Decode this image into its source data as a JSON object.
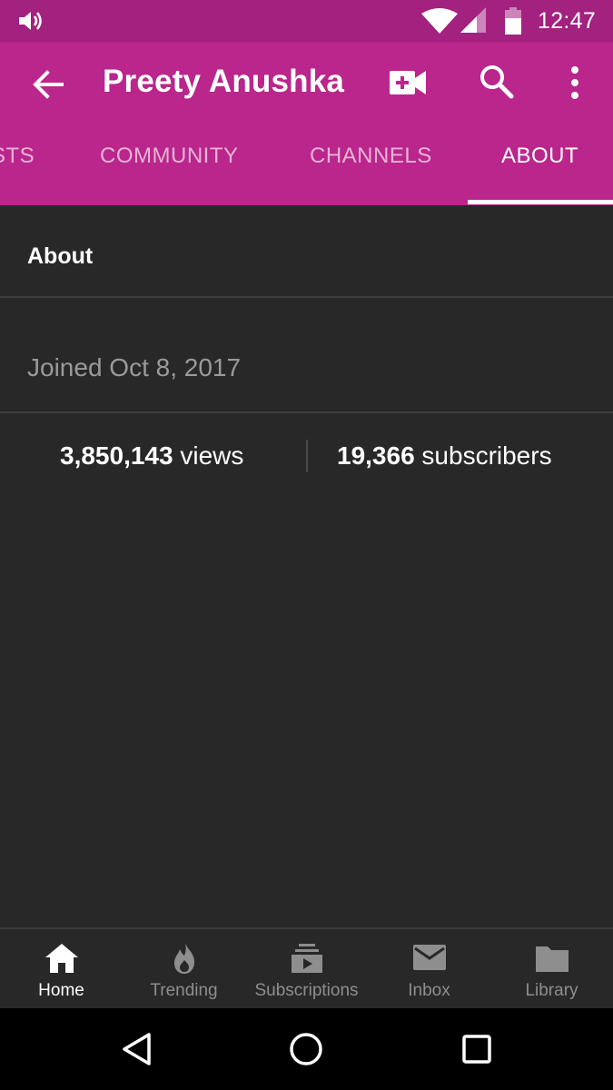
{
  "status_bar": {
    "time": "12:47",
    "icons": [
      "volume-icon",
      "wifi-icon",
      "signal-icon",
      "battery-icon"
    ]
  },
  "app_bar": {
    "title": "Preety Anushka",
    "icons": [
      "back-arrow-icon",
      "video-camera-add-icon",
      "search-icon",
      "more-vert-icon"
    ]
  },
  "tabs": [
    {
      "label": "STS",
      "active": false
    },
    {
      "label": "COMMUNITY",
      "active": false
    },
    {
      "label": "CHANNELS",
      "active": false
    },
    {
      "label": "ABOUT",
      "active": true
    }
  ],
  "about": {
    "section_title": "About",
    "joined": "Joined Oct 8, 2017",
    "views_count": "3,850,143",
    "views_label": " views",
    "subscribers_count": "19,366",
    "subscribers_label": " subscribers"
  },
  "bottom_nav": [
    {
      "label": "Home",
      "icon": "home-icon",
      "active": true
    },
    {
      "label": "Trending",
      "icon": "flame-icon",
      "active": false
    },
    {
      "label": "Subscriptions",
      "icon": "subscriptions-icon",
      "active": false
    },
    {
      "label": "Inbox",
      "icon": "mail-icon",
      "active": false
    },
    {
      "label": "Library",
      "icon": "folder-icon",
      "active": false
    }
  ],
  "system_nav": [
    "back-triangle-icon",
    "home-circle-icon",
    "recents-square-icon"
  ],
  "colors": {
    "status_bar": "#a3217f",
    "app_bar": "#ba268b",
    "background": "#282828"
  }
}
